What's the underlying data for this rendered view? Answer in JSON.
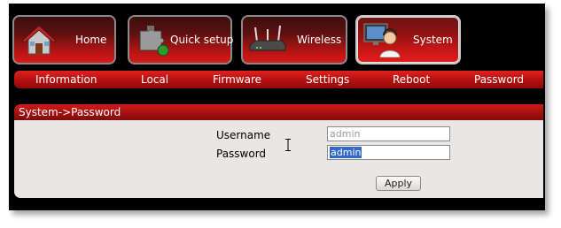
{
  "nav": {
    "tabs": [
      {
        "label": "Home",
        "icon": "house-icon"
      },
      {
        "label": "Quick setup",
        "icon": "puzzle-icon"
      },
      {
        "label": "Wireless",
        "icon": "router-icon"
      },
      {
        "label": "System",
        "icon": "computer-user-icon",
        "active": true
      }
    ]
  },
  "submenu": {
    "items": [
      "Information",
      "Local",
      "Firmware",
      "Settings",
      "Reboot",
      "Password"
    ]
  },
  "panel": {
    "title": "System->Password",
    "username_label": "Username",
    "username_value": "admin",
    "password_label": "Password",
    "password_value": "admin",
    "apply_label": "Apply"
  },
  "colors": {
    "accent_red": "#c41414",
    "frame": "#000000",
    "panel_bg": "#e9e7e5"
  }
}
